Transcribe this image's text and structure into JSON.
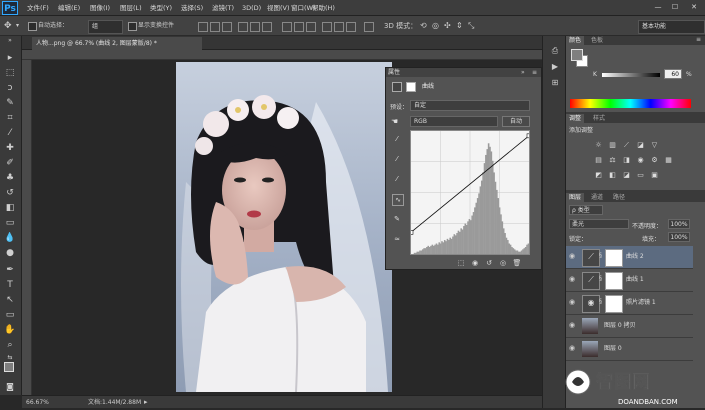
{
  "menubar": {
    "logo": "Ps",
    "items": [
      "文件(F)",
      "编辑(E)",
      "图像(I)",
      "图层(L)",
      "类型(Y)",
      "选择(S)",
      "滤镜(T)",
      "3D(D)",
      "视图(V)",
      "窗口(W)",
      "帮助(H)"
    ],
    "window_controls": [
      "—",
      "☐",
      "✕"
    ]
  },
  "options": {
    "auto_select_label": "自动选择：",
    "auto_select_value": "组",
    "show_transform_label": "显示变换控件",
    "workspace": "基本功能"
  },
  "document": {
    "tab_title": "人物...png @ 66.7% (曲线 2, 图层蒙版/8) *",
    "zoom": "66.67%",
    "doc_info": "文档:1.44M/2.88M"
  },
  "properties": {
    "title": "属性",
    "panel_name": "曲线",
    "preset_label": "预设：",
    "preset_value": "自定",
    "channel_value": "RGB",
    "auto_button": "自动",
    "histogram": [
      0,
      0,
      1,
      1,
      2,
      2,
      3,
      3,
      4,
      5,
      5,
      6,
      7,
      6,
      7,
      8,
      7,
      8,
      9,
      8,
      10,
      9,
      11,
      10,
      12,
      11,
      13,
      12,
      14,
      13,
      15,
      17,
      16,
      18,
      20,
      19,
      22,
      21,
      24,
      26,
      25,
      28,
      30,
      29,
      33,
      36,
      40,
      44,
      48,
      52,
      58,
      63,
      70,
      78,
      85,
      90,
      95,
      92,
      88,
      80,
      70,
      62,
      55,
      48,
      40,
      34,
      28,
      22,
      18,
      14,
      12,
      9,
      8,
      6,
      5,
      4,
      3,
      3,
      2,
      2,
      3,
      4,
      5,
      6,
      8,
      9
    ],
    "curve_points": [
      [
        0,
        45
      ],
      [
        255,
        245
      ]
    ]
  },
  "color_panel": {
    "tabs": [
      "颜色",
      "色板"
    ],
    "k_label": "K",
    "k_value": "60",
    "unit": "%",
    "fg": "#7f7f7f",
    "bg": "#ffffff"
  },
  "adjust_panel": {
    "tabs": [
      "调整",
      "样式"
    ],
    "title": "添加调整"
  },
  "layers_panel": {
    "tabs": [
      "图层",
      "通道",
      "路径"
    ],
    "kind_label": "ρ 类型",
    "blend_mode": "柔光",
    "opacity_label": "不透明度：",
    "opacity_value": "100%",
    "lock_label": "锁定：",
    "fill_label": "填充：",
    "fill_value": "100%",
    "layers": [
      {
        "name": "曲线 2",
        "kind": "curves",
        "selected": true
      },
      {
        "name": "曲线 1",
        "kind": "curves",
        "selected": false
      },
      {
        "name": "照片滤镜 1",
        "kind": "filter",
        "selected": false
      },
      {
        "name": "图层 0 拷贝",
        "kind": "photo",
        "selected": false
      },
      {
        "name": "图层 0",
        "kind": "photo",
        "selected": false
      }
    ]
  },
  "watermark": {
    "main": "智图网",
    "sub": "DOANDBAN.COM"
  }
}
